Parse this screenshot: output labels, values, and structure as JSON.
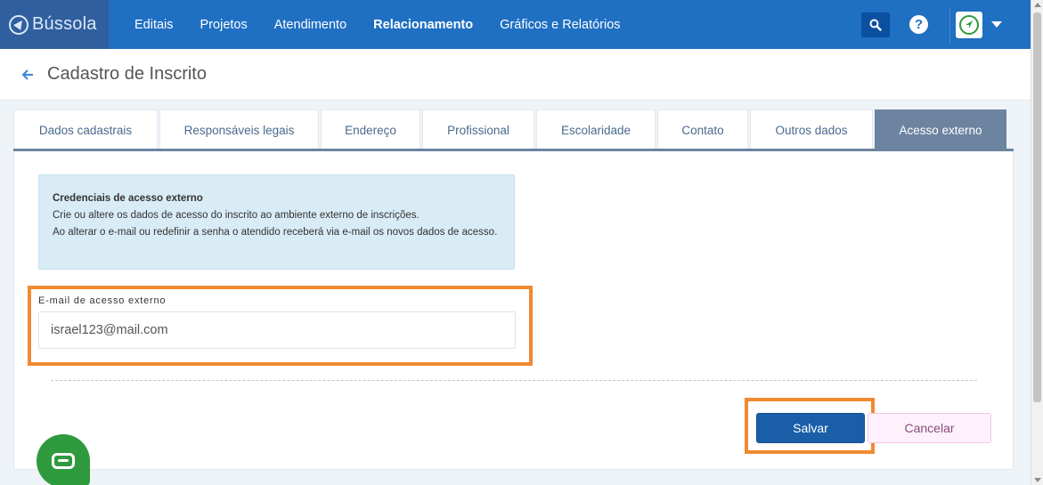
{
  "brand": {
    "name": "Bússola"
  },
  "nav": {
    "items": [
      {
        "label": "Editais",
        "active": false
      },
      {
        "label": "Projetos",
        "active": false
      },
      {
        "label": "Atendimento",
        "active": false
      },
      {
        "label": "Relacionamento",
        "active": true
      },
      {
        "label": "Gráficos e Relatórios",
        "active": false
      }
    ],
    "help_label": "?"
  },
  "page": {
    "title": "Cadastro de Inscrito"
  },
  "tabs": [
    {
      "label": "Dados cadastrais",
      "active": false
    },
    {
      "label": "Responsáveis legais",
      "active": false
    },
    {
      "label": "Endereço",
      "active": false
    },
    {
      "label": "Profissional",
      "active": false
    },
    {
      "label": "Escolaridade",
      "active": false
    },
    {
      "label": "Contato",
      "active": false
    },
    {
      "label": "Outros dados",
      "active": false
    },
    {
      "label": "Acesso externo",
      "active": true
    }
  ],
  "info": {
    "title": "Credenciais de acesso externo",
    "line1": "Crie ou altere os dados de acesso do inscrito ao ambiente externo de inscrições.",
    "line2": "Ao alterar o e-mail ou redefinir a senha o atendido receberá via e-mail os novos dados de acesso."
  },
  "form": {
    "email_label": "E-mail de acesso externo",
    "email_value": "israel123@mail.com"
  },
  "actions": {
    "save_label": "Salvar",
    "cancel_label": "Cancelar"
  },
  "colors": {
    "nav_bg": "#1f6fc2",
    "brand_bg": "#2f5f9e",
    "active_tab": "#6d84a0",
    "highlight": "#f08a31",
    "save_btn": "#1a5ea8",
    "chat_btn": "#2f9a3d"
  },
  "icons": [
    "compass-logo-icon",
    "search-icon",
    "help-icon",
    "user-avatar-icon",
    "caret-down-icon",
    "back-arrow-icon",
    "chat-icon"
  ]
}
